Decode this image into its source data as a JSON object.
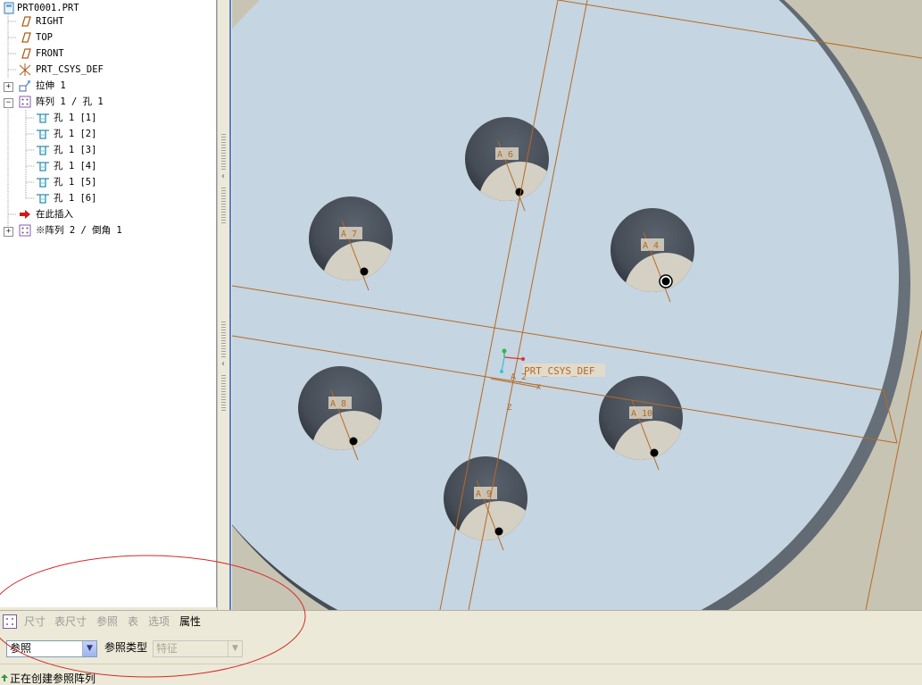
{
  "model_tree": {
    "items": [
      {
        "label": "PRT0001.PRT",
        "icon": "part-icon"
      },
      {
        "label": "RIGHT",
        "icon": "datum-plane-icon"
      },
      {
        "label": "TOP",
        "icon": "datum-plane-icon"
      },
      {
        "label": "FRONT",
        "icon": "datum-plane-icon"
      },
      {
        "label": "PRT_CSYS_DEF",
        "icon": "coordinate-system-icon"
      },
      {
        "label": "拉伸 1",
        "icon": "extrude-icon",
        "expander": "+"
      },
      {
        "label": "阵列 1 / 孔 1",
        "icon": "pattern-icon",
        "expander": "-"
      },
      {
        "label": "孔 1 [1]",
        "icon": "hole-icon"
      },
      {
        "label": "孔 1 [2]",
        "icon": "hole-icon"
      },
      {
        "label": "孔 1 [3]",
        "icon": "hole-icon"
      },
      {
        "label": "孔 1 [4]",
        "icon": "hole-icon"
      },
      {
        "label": "孔 1 [5]",
        "icon": "hole-icon"
      },
      {
        "label": "孔 1 [6]",
        "icon": "hole-icon"
      },
      {
        "label": "在此插入",
        "icon": "insert-arrow-icon"
      },
      {
        "label": "※阵列 2 / 倒角 1",
        "icon": "pattern-icon",
        "expander": "+"
      }
    ]
  },
  "viewport": {
    "csys_label": "PRT_CSYS_DEF",
    "axis_center_label": "A_2",
    "z_label": "Z",
    "x_label": "X",
    "holes": [
      {
        "axis": "A_6"
      },
      {
        "axis": "A_7"
      },
      {
        "axis": "A_4"
      },
      {
        "axis": "A_8"
      },
      {
        "axis": "A_10"
      },
      {
        "axis": "A_9"
      }
    ],
    "colors": {
      "face": "#c5d5e1",
      "hole": "#4e5660",
      "datum": "#b86a22",
      "background": "#c7c4b4"
    }
  },
  "dashboard": {
    "tabs": [
      "尺寸",
      "表尺寸",
      "参照",
      "表",
      "选项",
      "属性"
    ],
    "active_tab": "属性",
    "pattern_type_value": "参照",
    "reference_type_label": "参照类型",
    "reference_type_value": "特征"
  },
  "status": {
    "message": "正在创建参照阵列"
  }
}
